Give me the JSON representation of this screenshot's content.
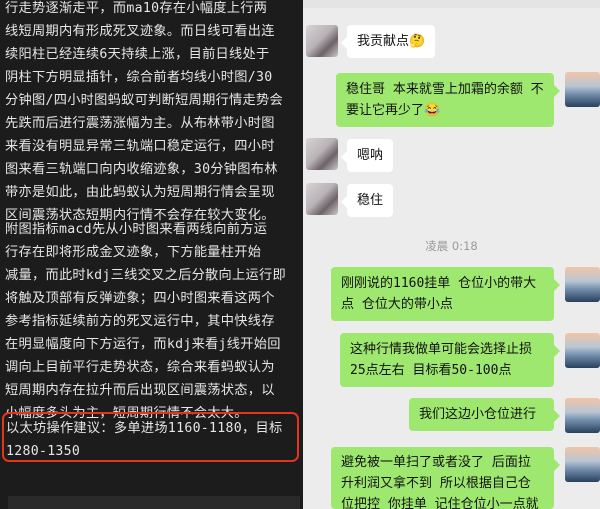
{
  "article": {
    "paragraph1": "行走势逐渐走平，而ma10存在小幅度上行两\n线短周期内有形成死叉迹象。而日线可看出连\n续阳柱已经连续6天持续上涨，目前日线处于\n阴柱下方明显插针，综合前者均线小时图/30\n分钟图/四小时图蚂蚁可判断短周期行情走势会\n先跌而后进行震荡涨幅为主。从布林带小时图\n来看没有明显异常三轨端口稳定运行，四小时\n图来看三轨端口向内收缩迹象，30分钟图布林\n带亦是如此，由此蚂蚁认为短周期行情会呈现\n区间震荡状态短期内行情不会存在较大变化。",
    "paragraph2": "附图指标macd先从小时图来看两线向前方运\n行存在即将形成金叉迹象，下方能量柱开始\n减量，而此时kdj三线交叉之后分散向上运行即\n将触及顶部有反弹迹象；四小时图来看这两个\n参考指标延续前方的死叉运行中，其中快线存\n在明显幅度向下方运行，而kdj来看j线开始回\n调向上目前平行走势状态，综合来看蚂蚁认为\n短周期内存在拉升而后出现区间震荡状态，以\n小幅度多头为主，短周期行情不会太大。",
    "advice": "以太坊操作建议：多单进场1160-1180，目标\n1280-1350"
  },
  "chat": {
    "messages": [
      {
        "side": "left",
        "text": "我贡献点🤔"
      },
      {
        "side": "right",
        "text": "稳住哥 本来就雪上加霜的余额 不\n要让它再少了😂"
      },
      {
        "side": "left",
        "text": "嗯呐"
      },
      {
        "side": "left",
        "text": "稳住"
      },
      {
        "side": "right",
        "text": "刚刚说的1160挂单 仓位小的带大\n点 仓位大的带小点"
      },
      {
        "side": "right",
        "text": "这种行情我做单可能会选择止损\n25点左右 目标看50-100点"
      },
      {
        "side": "right",
        "text": "我们这边小仓位进行"
      },
      {
        "side": "right",
        "text": "避免被一单扫了或者没了 后面拉\n升利润又拿不到 所以根据自己仓\n位把控 你挂单 记住仓位小一点就"
      }
    ],
    "timestamp": "凌晨 0:18"
  }
}
